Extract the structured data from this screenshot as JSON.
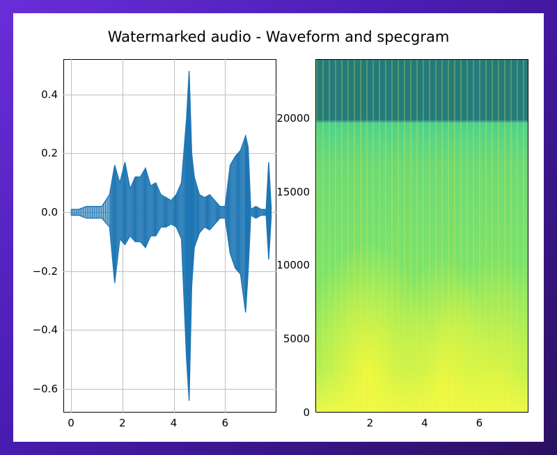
{
  "title": "Watermarked audio - Waveform and specgram",
  "chart_data": [
    {
      "type": "line",
      "name": "waveform",
      "title": "",
      "xlabel": "",
      "ylabel": "",
      "xlim": [
        -0.3,
        8.0
      ],
      "ylim": [
        -0.68,
        0.52
      ],
      "x_ticks": [
        0,
        2,
        4,
        6
      ],
      "y_ticks": [
        -0.6,
        -0.4,
        -0.2,
        0.0,
        0.2,
        0.4
      ],
      "note": "audio waveform; values are amplitude envelope over time (s)",
      "series": [
        {
          "name": "audio",
          "x": [
            0.0,
            0.3,
            0.6,
            0.9,
            1.2,
            1.5,
            1.7,
            1.9,
            2.1,
            2.3,
            2.5,
            2.7,
            2.9,
            3.1,
            3.3,
            3.5,
            3.7,
            3.9,
            4.1,
            4.3,
            4.5,
            4.6,
            4.7,
            4.8,
            5.0,
            5.2,
            5.4,
            5.6,
            5.8,
            6.0,
            6.2,
            6.4,
            6.6,
            6.8,
            6.9,
            7.0,
            7.2,
            7.4,
            7.6,
            7.7,
            7.8
          ],
          "env_pos": [
            0.01,
            0.01,
            0.02,
            0.02,
            0.02,
            0.06,
            0.16,
            0.1,
            0.17,
            0.08,
            0.12,
            0.12,
            0.15,
            0.09,
            0.1,
            0.06,
            0.05,
            0.04,
            0.06,
            0.1,
            0.32,
            0.48,
            0.2,
            0.12,
            0.06,
            0.05,
            0.06,
            0.04,
            0.02,
            0.02,
            0.16,
            0.19,
            0.21,
            0.26,
            0.22,
            0.01,
            0.02,
            0.01,
            0.01,
            0.17,
            0.01
          ],
          "env_neg": [
            -0.01,
            -0.01,
            -0.02,
            -0.02,
            -0.02,
            -0.05,
            -0.24,
            -0.09,
            -0.11,
            -0.08,
            -0.1,
            -0.1,
            -0.12,
            -0.08,
            -0.08,
            -0.05,
            -0.05,
            -0.04,
            -0.05,
            -0.09,
            -0.5,
            -0.64,
            -0.25,
            -0.12,
            -0.07,
            -0.05,
            -0.06,
            -0.04,
            -0.02,
            -0.02,
            -0.14,
            -0.19,
            -0.21,
            -0.34,
            -0.2,
            -0.01,
            -0.02,
            -0.01,
            -0.01,
            -0.16,
            -0.01
          ]
        }
      ]
    },
    {
      "type": "heatmap",
      "name": "spectrogram",
      "title": "",
      "xlabel": "",
      "ylabel": "",
      "xlim": [
        0,
        7.8
      ],
      "ylim": [
        0,
        24000
      ],
      "x_ticks": [
        2,
        4,
        6
      ],
      "y_ticks": [
        0,
        5000,
        10000,
        15000,
        20000
      ],
      "note": "spectrogram intensity (viridis-like); low-frequency energy dominant below ~5 kHz, sharp cutoff near 20500 Hz"
    }
  ]
}
